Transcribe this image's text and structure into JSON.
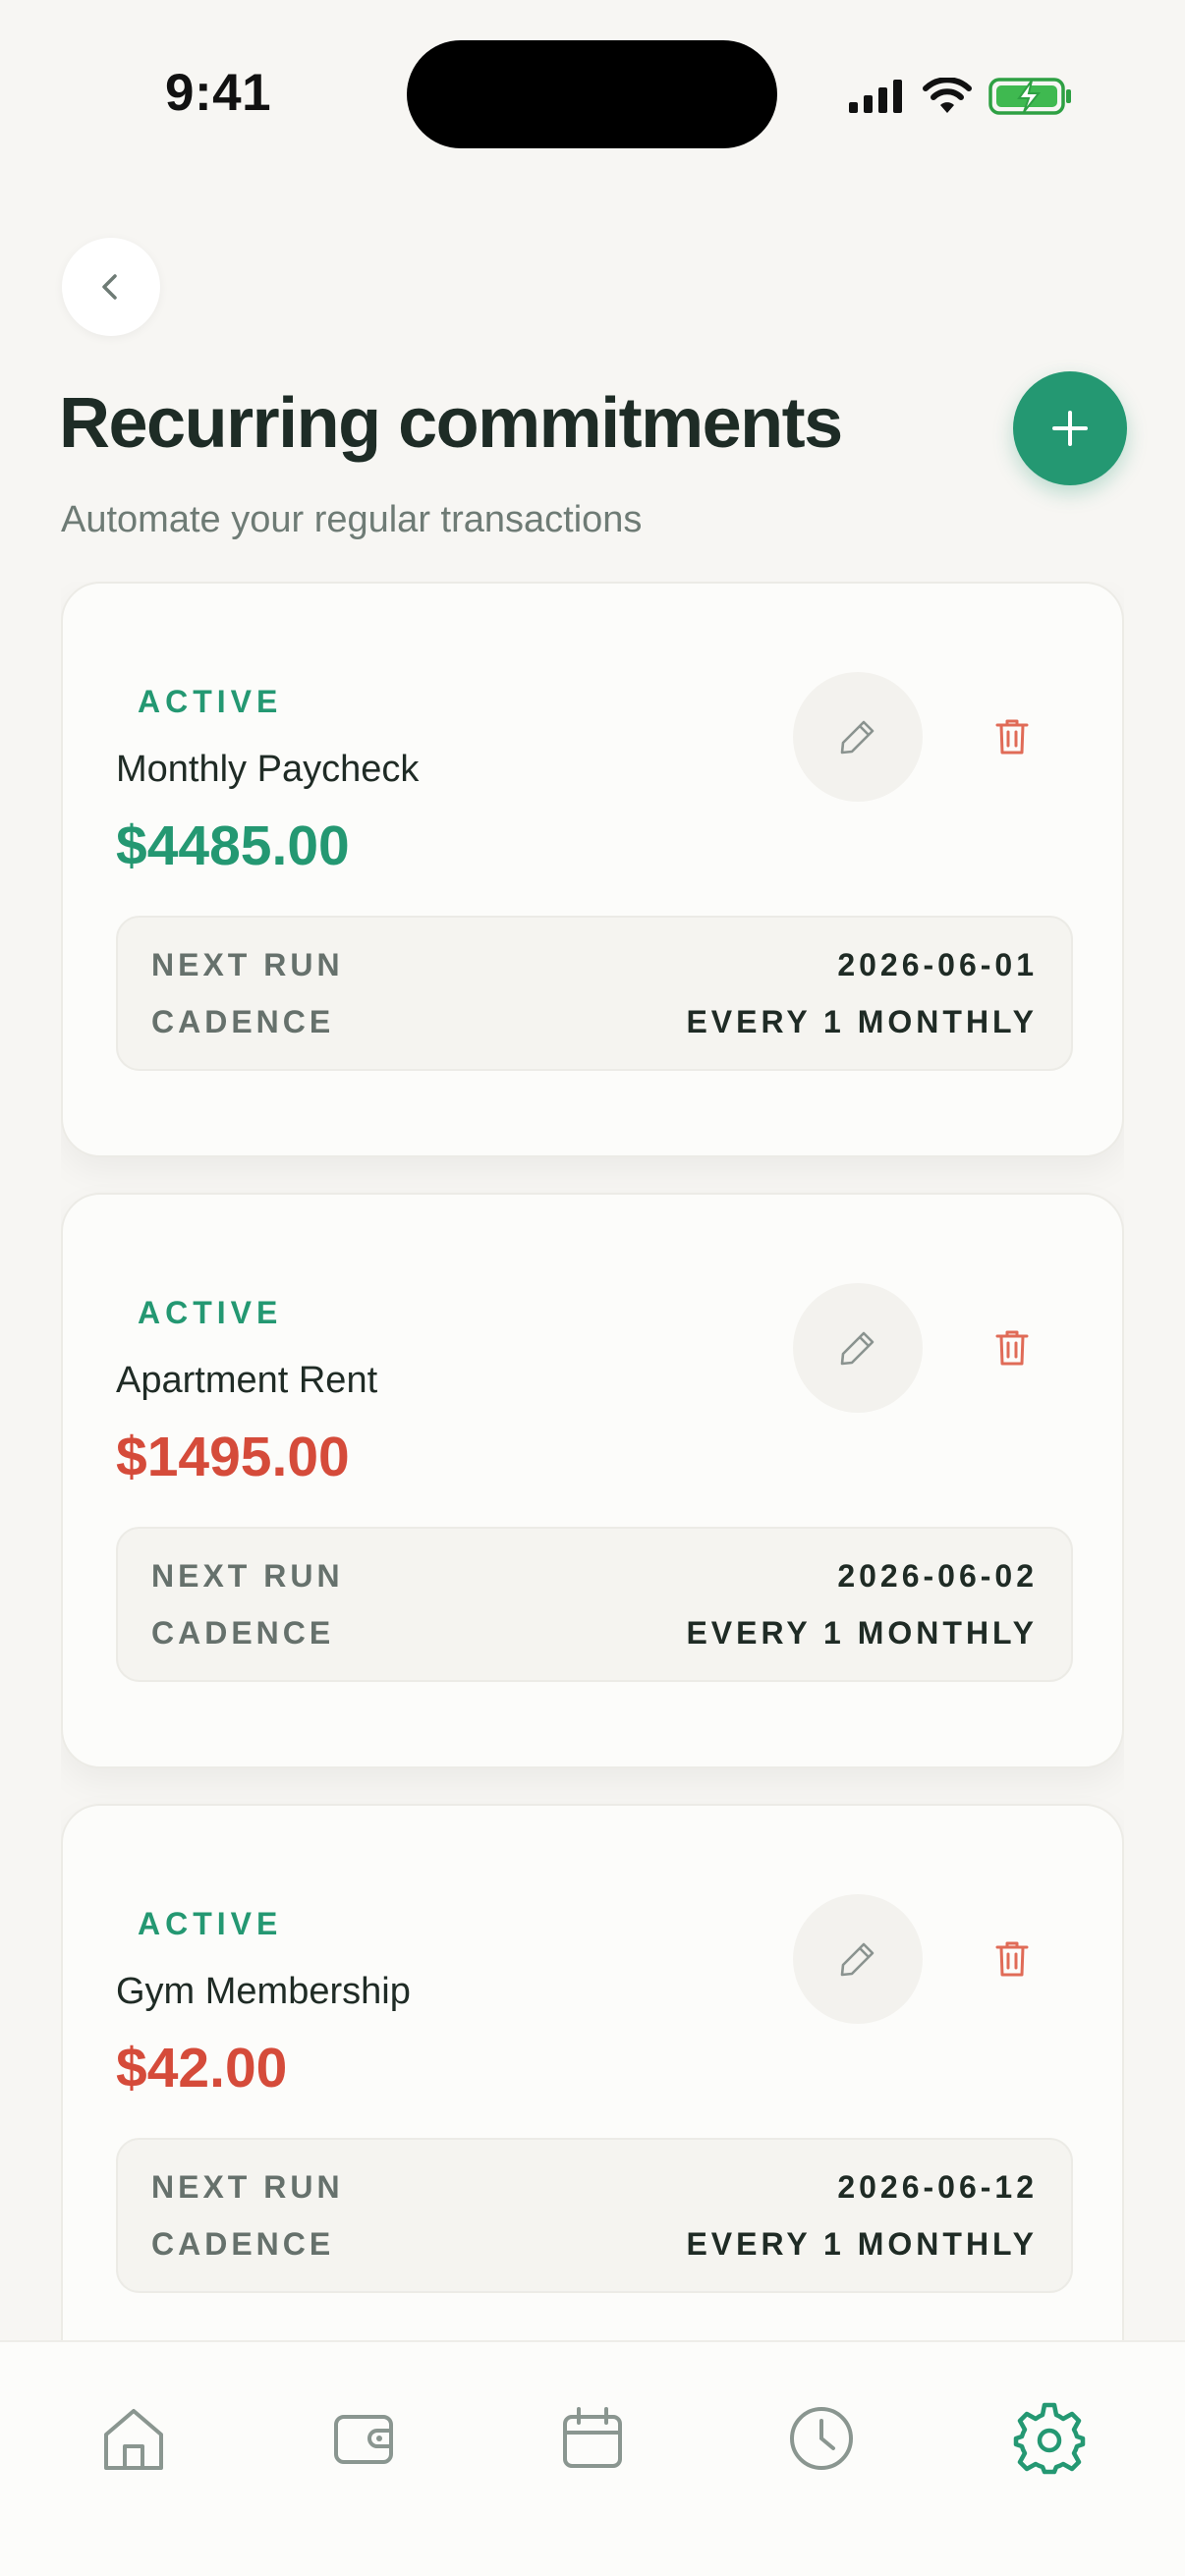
{
  "status_bar": {
    "time": "9:41"
  },
  "header": {
    "title": "Recurring commitments",
    "subtitle": "Automate your regular transactions"
  },
  "colors": {
    "accent": "#249872",
    "expense": "#d54b3a",
    "background": "#f7f6f3"
  },
  "labels": {
    "next_run": "NEXT RUN",
    "cadence": "CADENCE"
  },
  "commitments": [
    {
      "status": "ACTIVE",
      "name": "Monthly Paycheck",
      "amount": "$4485.00",
      "type": "income",
      "next_run": "2026-06-01",
      "cadence": "EVERY 1 MONTHLY"
    },
    {
      "status": "ACTIVE",
      "name": "Apartment Rent",
      "amount": "$1495.00",
      "type": "expense",
      "next_run": "2026-06-02",
      "cadence": "EVERY 1 MONTHLY"
    },
    {
      "status": "ACTIVE",
      "name": "Gym Membership",
      "amount": "$42.00",
      "type": "expense",
      "next_run": "2026-06-12",
      "cadence": "EVERY 1 MONTHLY"
    }
  ],
  "tab_bar": {
    "items": [
      {
        "icon": "home-icon",
        "active": false
      },
      {
        "icon": "wallet-icon",
        "active": false
      },
      {
        "icon": "calendar-icon",
        "active": false
      },
      {
        "icon": "clock-icon",
        "active": false
      },
      {
        "icon": "gear-icon",
        "active": true
      }
    ]
  }
}
